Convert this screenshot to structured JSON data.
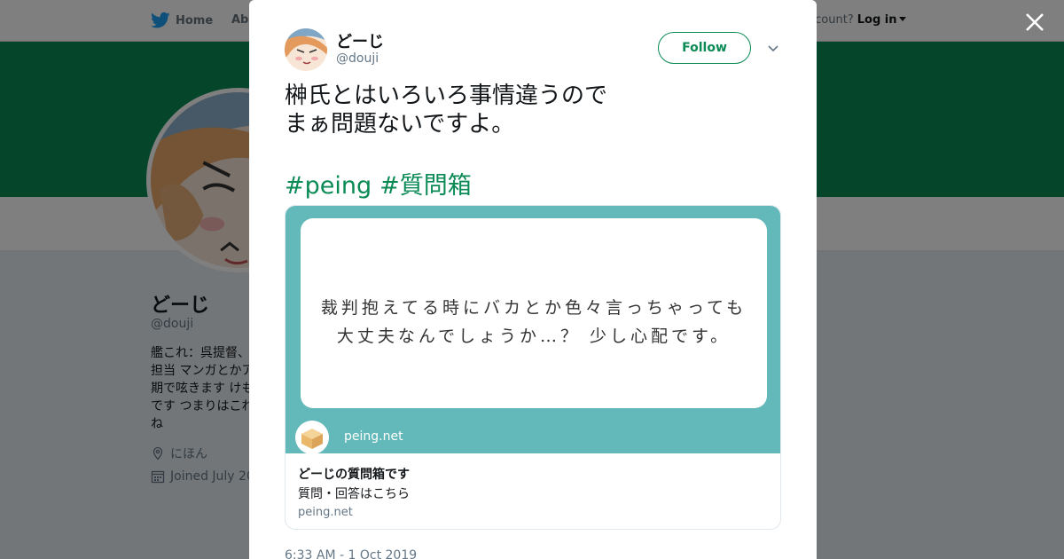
{
  "topnav": {
    "home_label": "Home",
    "about_label": "Abo",
    "account_prompt": "ccount?",
    "login_label": "Log in"
  },
  "profile": {
    "name": "どーじ",
    "handle": "@douji",
    "bio_lines": [
      "艦これ：呉提督、",
      "担当 マンガとかア",
      "期で呟きます けも",
      "です つまりはこれ",
      "ね"
    ],
    "location": "にほん",
    "joined": "Joined July 20"
  },
  "tweet": {
    "author_name": "どーじ",
    "author_handle": "@douji",
    "follow_label": "Follow",
    "text_lines": [
      "榊氏とはいろいろ事情違うので",
      "まぁ問題ないですよ。"
    ],
    "hashtags": [
      "#peing",
      "#質問箱"
    ],
    "timestamp": "6:33 AM - 1 Oct 2019"
  },
  "card": {
    "question_line1": "裁判抱えてる時にバカとか色々言っちゃっても",
    "question_line2": "大丈夫なんでしょうか…？ 少し心配です。",
    "image_site_label": "peing.net",
    "title": "どーじの質問箱です",
    "description": "質問・回答はこちら",
    "domain": "peing.net"
  },
  "colors": {
    "accent": "#0a8a55",
    "card_teal": "#63b9b9",
    "text": "#14171a",
    "muted": "#657786"
  },
  "icons": [
    "twitter-bird-icon",
    "close-icon",
    "chevron-down-icon",
    "location-pin-icon",
    "calendar-icon",
    "box-logo-icon"
  ]
}
